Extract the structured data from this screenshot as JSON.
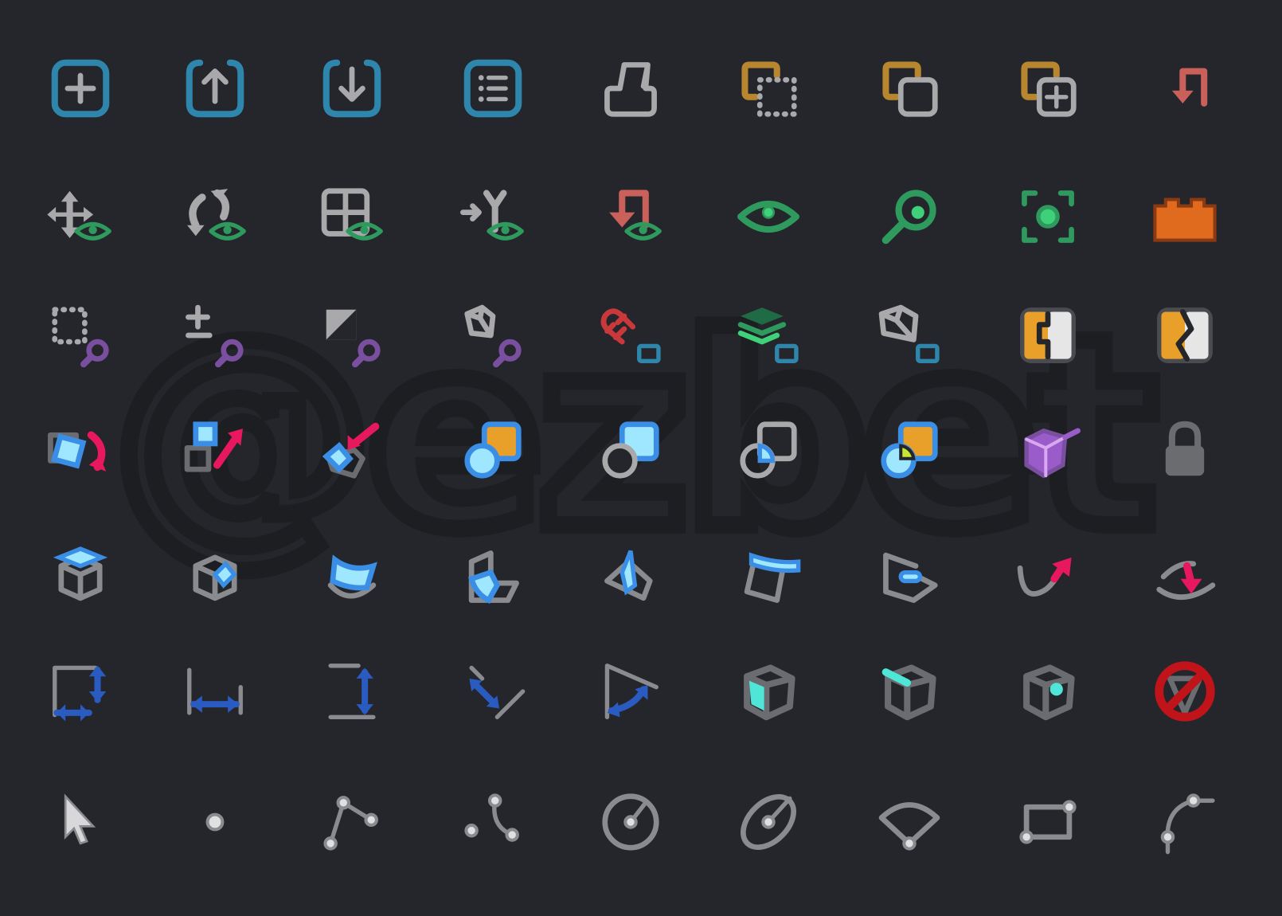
{
  "watermark": "@ezbet",
  "colors": {
    "background": "#25262b",
    "blue": "#2f86ad",
    "gray": "#a9a9ac",
    "green": "#2e9a5e",
    "gold": "#b8862e",
    "red": "#c9605a",
    "purple": "#7a4fa0",
    "pink": "#e8185f",
    "bright_blue": "#3a8ee6",
    "light_blue": "#9fe6ff",
    "dark_blue": "#2a5bc0",
    "orange": "#e8a02a",
    "cyan": "#4fe6d8",
    "forbidden_red": "#c0141a"
  },
  "icons": [
    [
      "add-box-icon",
      "export-box-icon",
      "import-box-icon",
      "list-box-icon",
      "tray-icon",
      "selection-copy-icon",
      "duplicate-icon",
      "duplicate-add-icon",
      "undo-arrow-icon"
    ],
    [
      "move-view-icon",
      "rotate-view-icon",
      "grid-view-icon",
      "merge-view-icon",
      "undo-view-icon",
      "eye-icon",
      "search-view-icon",
      "focus-view-icon",
      "brick-icon"
    ],
    [
      "select-search-icon",
      "plus-minus-search-icon",
      "contrast-search-icon",
      "cube-search-icon",
      "magnet-window-icon",
      "layers-window-icon",
      "cube-window-icon",
      "split-object-icon",
      "break-object-icon"
    ],
    [
      "rotate-object-icon",
      "scale-object-icon",
      "push-face-icon",
      "union-icon",
      "subtract-icon",
      "intersect-icon",
      "boolean-split-icon",
      "open-box-icon",
      "lock-icon"
    ],
    [
      "box-top-face-icon",
      "box-corner-face-icon",
      "curved-face-icon",
      "fold-face-icon",
      "wedge-face-icon",
      "sweep-face-icon",
      "project-face-icon",
      "curve-arrow-up-icon",
      "curve-arrow-down-icon"
    ],
    [
      "dimension-corner-icon",
      "dimension-horizontal-icon",
      "dimension-vertical-icon",
      "dimension-aligned-icon",
      "dimension-angle-icon",
      "cube-face-select-icon",
      "cube-edge-select-icon",
      "cube-vertex-select-icon",
      "forbidden-icon"
    ],
    [
      "pointer-icon",
      "point-icon",
      "polyline-icon",
      "curve-points-icon",
      "circle-radius-icon",
      "ellipse-icon",
      "arc-sector-icon",
      "rectangle-points-icon",
      "spline-icon"
    ]
  ]
}
